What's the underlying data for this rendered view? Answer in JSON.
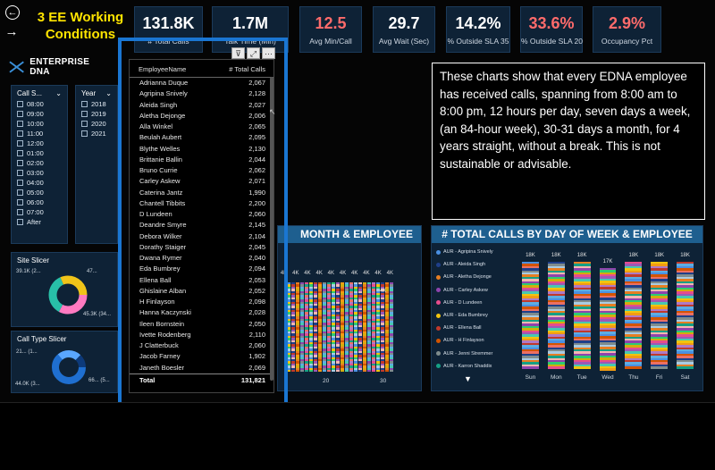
{
  "title": "3 EE Working Conditions",
  "kpis": [
    {
      "value": "131.8K",
      "label": "# Total Calls",
      "color": "#ffffff"
    },
    {
      "value": "1.7M",
      "label": "Talk Time (Min)",
      "color": "#ffffff"
    },
    {
      "value": "12.5",
      "label": "Avg Min/Call",
      "color": "#ff6b6b"
    },
    {
      "value": "29.7",
      "label": "Avg Wait (Sec)",
      "color": "#ffffff"
    },
    {
      "value": "14.2%",
      "label": "% Outside SLA 35",
      "color": "#ffffff"
    },
    {
      "value": "33.6%",
      "label": "% Outside SLA 20",
      "color": "#ff6b6b"
    },
    {
      "value": "2.9%",
      "label": "Occupancy Pct",
      "color": "#ff6b6b"
    }
  ],
  "logo": "ENTERPRISE DNA",
  "call_slicer": {
    "header": "Call S...",
    "options": [
      "08:00",
      "09:00",
      "10:00",
      "11:00",
      "12:00",
      "01:00",
      "02:00",
      "03:00",
      "04:00",
      "05:00",
      "06:00",
      "07:00",
      "After"
    ]
  },
  "year_slicer": {
    "header": "Year",
    "options": [
      "2018",
      "2019",
      "2020",
      "2021"
    ]
  },
  "site_slicer": {
    "header": "Site Slicer",
    "labels": [
      "39.1K (2...",
      "47...",
      "45.3K (34..."
    ]
  },
  "calltype_slicer": {
    "header": "Call Type Slicer",
    "labels": [
      "21... (1...",
      "44.0K (3...",
      "66... (5..."
    ]
  },
  "textbox": "These charts show that every EDNA employee has received calls, spanning from 8:00 am to 8:00 pm, 12 hours per day, seven days a week, (an 84-hour week), 30-31 days a month, for 4 years straight, without a break. This is not sustainable or advisable.",
  "month_chart": {
    "title": "MONTH & EMPLOYEE",
    "bar_labels": [
      "4K",
      "4K",
      "4K",
      "4K",
      "4K",
      "4K",
      "4K",
      "4K",
      "4K",
      "4K"
    ],
    "last_label": "4K",
    "x_ticks": [
      "20",
      "30"
    ]
  },
  "dow_chart": {
    "title": "# TOTAL CALLS BY DAY OF WEEK & EMPLOYEE",
    "legend": [
      {
        "name": "AUR - Agripina Snively",
        "color": "#4a90e2"
      },
      {
        "name": "AUR - Aleida Singh",
        "color": "#1f3f8a"
      },
      {
        "name": "AUR - Aletha Dejonge",
        "color": "#e67e22"
      },
      {
        "name": "AUR - Carley Askew",
        "color": "#8e44ad"
      },
      {
        "name": "AUR - D Lundeen",
        "color": "#e74c8c"
      },
      {
        "name": "AUR - Eda Bumbrey",
        "color": "#f1c40f"
      },
      {
        "name": "AUR - Ellena Ball",
        "color": "#c0392b"
      },
      {
        "name": "AUR - H Finlayson",
        "color": "#d35400"
      },
      {
        "name": "AUR - Jenni Stremmer",
        "color": "#7f8c8d"
      },
      {
        "name": "AUR - Karron Shaddix",
        "color": "#16a085"
      }
    ],
    "days": [
      "Sun",
      "Mon",
      "Tue",
      "Wed",
      "Thu",
      "Fri",
      "Sat"
    ],
    "values": [
      "18K",
      "18K",
      "18K",
      "17K",
      "18K",
      "18K",
      "18K"
    ]
  },
  "table": {
    "col1": "EmployeeName",
    "col2": "# Total Calls",
    "rows": [
      [
        "Adrianna Duque",
        "2,067"
      ],
      [
        "Agripina Snively",
        "2,128"
      ],
      [
        "Aleida Singh",
        "2,027"
      ],
      [
        "Aletha Dejonge",
        "2,006"
      ],
      [
        "Alla Winkel",
        "2,065"
      ],
      [
        "Beulah Aubert",
        "2,095"
      ],
      [
        "Blythe Welles",
        "2,130"
      ],
      [
        "Brittanie Ballin",
        "2,044"
      ],
      [
        "Bruno Currie",
        "2,062"
      ],
      [
        "Carley Askew",
        "2,071"
      ],
      [
        "Caterina Jantz",
        "1,990"
      ],
      [
        "Chantell Tibbits",
        "2,200"
      ],
      [
        "D Lundeen",
        "2,060"
      ],
      [
        "Deandre Smyre",
        "2,145"
      ],
      [
        "Debora Wilker",
        "2,104"
      ],
      [
        "Dorathy Staiger",
        "2,045"
      ],
      [
        "Dwana Rymer",
        "2,040"
      ],
      [
        "Eda Bumbrey",
        "2,094"
      ],
      [
        "Ellena Ball",
        "2,053"
      ],
      [
        "Ghislaine Alban",
        "2,052"
      ],
      [
        "H Finlayson",
        "2,098"
      ],
      [
        "Hanna Kaczynski",
        "2,028"
      ],
      [
        "Ileen Bornstein",
        "2,050"
      ],
      [
        "Ivette Rodenberg",
        "2,110"
      ],
      [
        "J Clatterbuck",
        "2,060"
      ],
      [
        "Jacob Farney",
        "1,902"
      ],
      [
        "Janeth Boesler",
        "2,069"
      ]
    ],
    "total_label": "Total",
    "total_value": "131,821"
  }
}
